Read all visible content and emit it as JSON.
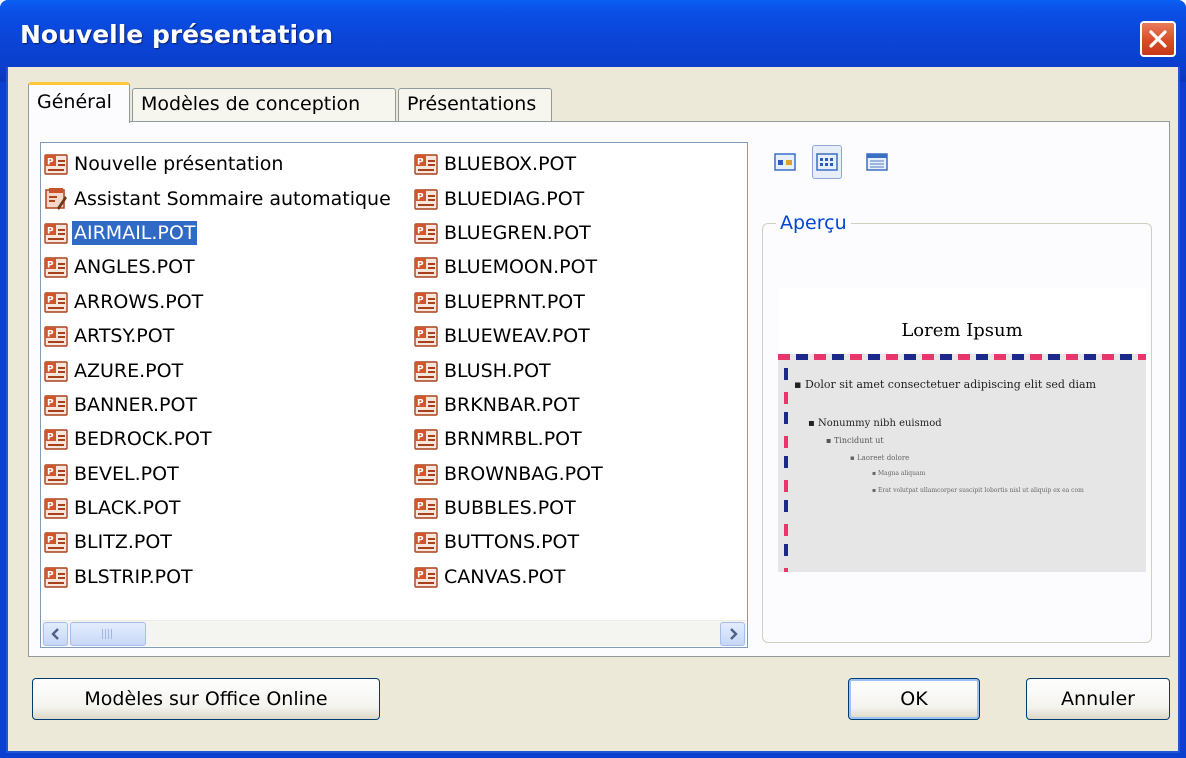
{
  "window": {
    "title": "Nouvelle présentation"
  },
  "tabs": [
    {
      "label": "Général",
      "active": true
    },
    {
      "label": "Modèles de conception",
      "active": false
    },
    {
      "label": "Présentations",
      "active": false
    }
  ],
  "list": {
    "column1": [
      {
        "label": "Nouvelle présentation",
        "icon": "presentation-icon"
      },
      {
        "label": "Assistant Sommaire automatique",
        "icon": "wizard-icon"
      },
      {
        "label": "AIRMAIL.POT",
        "icon": "template-icon",
        "selected": true
      },
      {
        "label": "ANGLES.POT",
        "icon": "template-icon"
      },
      {
        "label": "ARROWS.POT",
        "icon": "template-icon"
      },
      {
        "label": "ARTSY.POT",
        "icon": "template-icon"
      },
      {
        "label": "AZURE.POT",
        "icon": "template-icon"
      },
      {
        "label": "BANNER.POT",
        "icon": "template-icon"
      },
      {
        "label": "BEDROCK.POT",
        "icon": "template-icon"
      },
      {
        "label": "BEVEL.POT",
        "icon": "template-icon"
      },
      {
        "label": "BLACK.POT",
        "icon": "template-icon"
      },
      {
        "label": "BLITZ.POT",
        "icon": "template-icon"
      },
      {
        "label": "BLSTRIP.POT",
        "icon": "template-icon"
      }
    ],
    "column2": [
      {
        "label": "BLUEBOX.POT",
        "icon": "template-icon"
      },
      {
        "label": "BLUEDIAG.POT",
        "icon": "template-icon"
      },
      {
        "label": "BLUEGREN.POT",
        "icon": "template-icon"
      },
      {
        "label": "BLUEMOON.POT",
        "icon": "template-icon"
      },
      {
        "label": "BLUEPRNT.POT",
        "icon": "template-icon"
      },
      {
        "label": "BLUEWEAV.POT",
        "icon": "template-icon"
      },
      {
        "label": "BLUSH.POT",
        "icon": "template-icon"
      },
      {
        "label": "BRKNBAR.POT",
        "icon": "template-icon"
      },
      {
        "label": "BRNMRBL.POT",
        "icon": "template-icon"
      },
      {
        "label": "BROWNBAG.POT",
        "icon": "template-icon"
      },
      {
        "label": "BUBBLES.POT",
        "icon": "template-icon"
      },
      {
        "label": "BUTTONS.POT",
        "icon": "template-icon"
      },
      {
        "label": "CANVAS.POT",
        "icon": "template-icon"
      }
    ]
  },
  "view_buttons": [
    {
      "name": "large-icons-view-icon",
      "pressed": false
    },
    {
      "name": "list-view-icon",
      "pressed": true
    },
    {
      "name": "details-view-icon",
      "pressed": false
    }
  ],
  "preview": {
    "legend": "Aperçu",
    "slide_title": "Lorem Ipsum",
    "bullet1": "Dolor sit amet consectetuer adipiscing elit sed diam",
    "bullet2": "Nonummy nibh euismod",
    "bullet3": "Tincidunt ut",
    "bullet4": "Laoreet dolore",
    "bullet5": "Magna aliquam",
    "bullet6": "Erat volutpat ullamcorper suscipit lobortis nisl ut aliquip ex ea com"
  },
  "buttons": {
    "online": "Modèles sur Office Online",
    "ok": "OK",
    "cancel": "Annuler"
  },
  "colors": {
    "titlebar": "#0b44d6",
    "selection": "#316ac5",
    "stripe_red": "#e8356c",
    "stripe_blue": "#1b2a8a"
  }
}
